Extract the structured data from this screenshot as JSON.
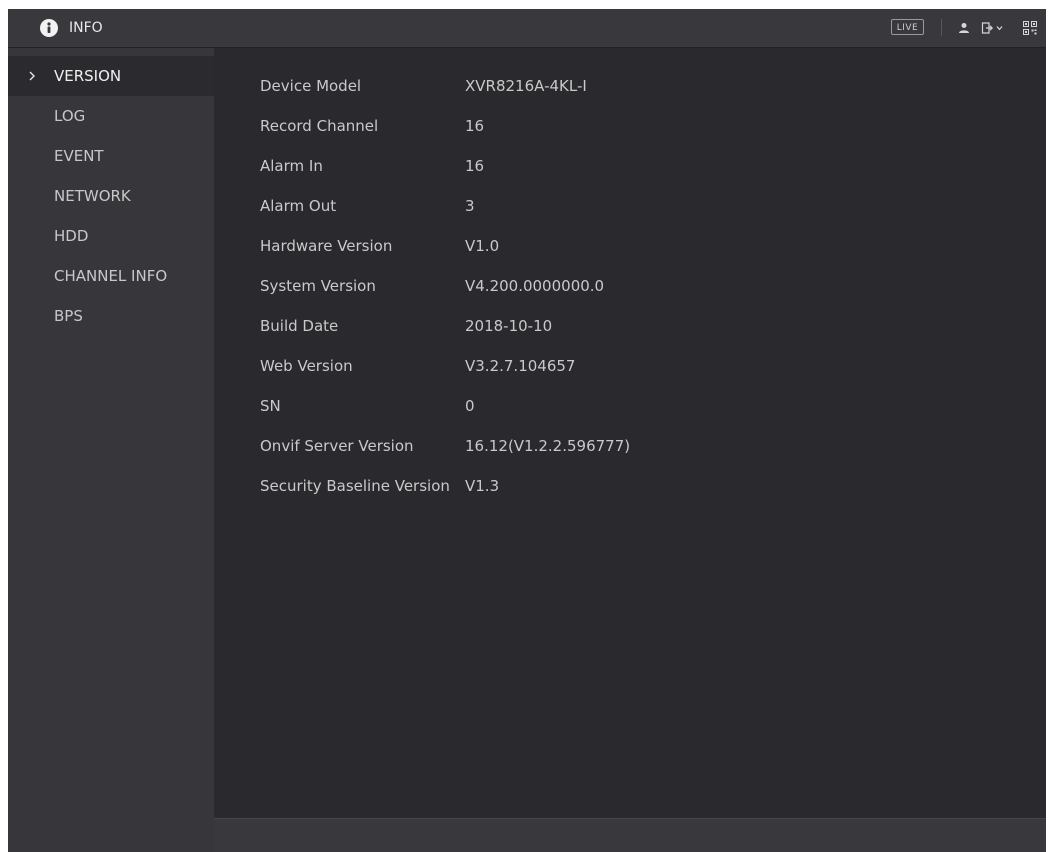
{
  "header": {
    "title": "INFO",
    "title_icon": "info-circle-icon",
    "live_label": "LIVE",
    "icons": [
      "user-icon",
      "logout-icon",
      "qr-code-icon"
    ]
  },
  "sidebar": {
    "items": [
      {
        "label": "VERSION",
        "active": true
      },
      {
        "label": "LOG",
        "active": false
      },
      {
        "label": "EVENT",
        "active": false
      },
      {
        "label": "NETWORK",
        "active": false
      },
      {
        "label": "HDD",
        "active": false
      },
      {
        "label": "CHANNEL INFO",
        "active": false
      },
      {
        "label": "BPS",
        "active": false
      }
    ]
  },
  "version_info": [
    {
      "label": "Device Model",
      "value": "XVR8216A-4KL-I"
    },
    {
      "label": "Record Channel",
      "value": "16"
    },
    {
      "label": "Alarm In",
      "value": "16"
    },
    {
      "label": "Alarm Out",
      "value": "3"
    },
    {
      "label": "Hardware Version",
      "value": "V1.0"
    },
    {
      "label": "System Version",
      "value": "V4.200.0000000.0"
    },
    {
      "label": "Build Date",
      "value": "2018-10-10"
    },
    {
      "label": "Web Version",
      "value": "V3.2.7.104657"
    },
    {
      "label": "SN",
      "value": "0"
    },
    {
      "label": "Onvif Server Version",
      "value": "16.12(V1.2.2.596777)"
    },
    {
      "label": "Security Baseline Version",
      "value": "V1.3"
    }
  ],
  "colors": {
    "background": "#2a2a2e",
    "sidebar": "#37373b",
    "topbar": "#38383d",
    "text": "#c9c9c9"
  }
}
